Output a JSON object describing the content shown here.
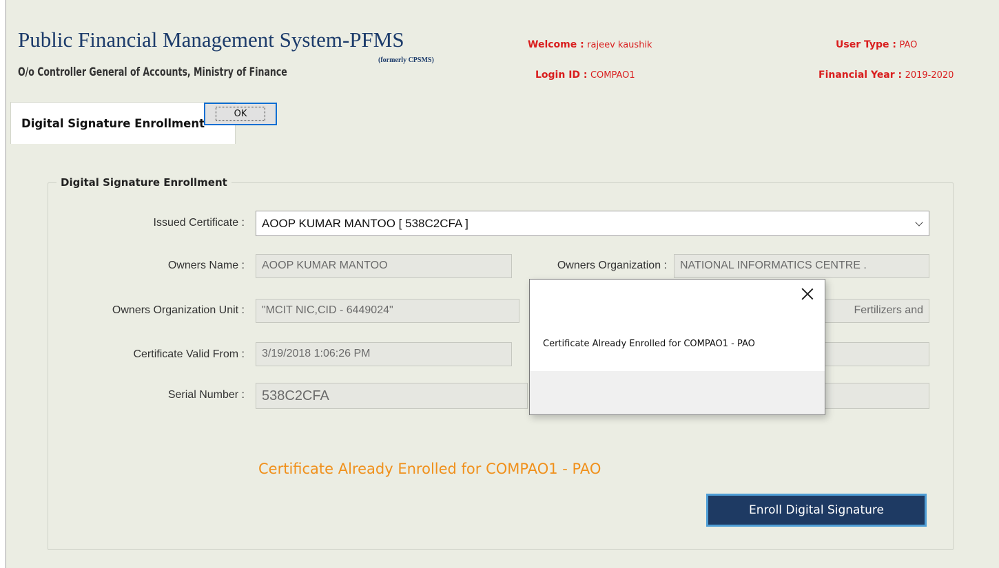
{
  "header": {
    "app_title": "Public Financial Management System-PFMS",
    "formerly": "(formerly CPSMS)",
    "subtitle": "O/o Controller General of Accounts, Ministry of Finance",
    "welcome_label": "Welcome :",
    "welcome_value": "rajeev kaushik",
    "login_label": "Login ID :",
    "login_value": "COMPAO1",
    "user_type_label": "User Type :",
    "user_type_value": "PAO",
    "fy_label": "Financial Year :",
    "fy_value": "2019-2020"
  },
  "tabs": [
    {
      "label": "Digital Signature Enrollment",
      "active": true
    }
  ],
  "form": {
    "legend": "Digital Signature Enrollment",
    "issued_certificate": {
      "label": "Issued Certificate :",
      "value": "AOOP KUMAR MANTOO [ 538C2CFA ]"
    },
    "owners_name": {
      "label": "Owners Name :",
      "value": "AOOP KUMAR MANTOO"
    },
    "owners_organization": {
      "label": "Owners Organization :",
      "value": "NATIONAL INFORMATICS CENTRE ."
    },
    "owners_org_unit": {
      "label": "Owners Organization Unit :",
      "value": "\"MCIT NIC,CID - 6449024\""
    },
    "owners_org_unit_right_value": "Fertilizers and",
    "valid_from": {
      "label": "Certificate Valid From :",
      "value": "3/19/2018 1:06:26 PM"
    },
    "serial_number": {
      "label": "Serial Number :",
      "value": "538C2CFA"
    },
    "status_message": "Certificate Already Enrolled for COMPAO1 - PAO",
    "enroll_button": "Enroll Digital Signature"
  },
  "dialog": {
    "message": "Certificate Already Enrolled for COMPAO1 - PAO",
    "ok_label": "OK"
  },
  "colors": {
    "brand": "#1d3c6b",
    "header_red": "#d91e1e",
    "status_orange": "#f0901b",
    "button_bg": "#1e3a63",
    "panel_bg": "#ebede3"
  }
}
